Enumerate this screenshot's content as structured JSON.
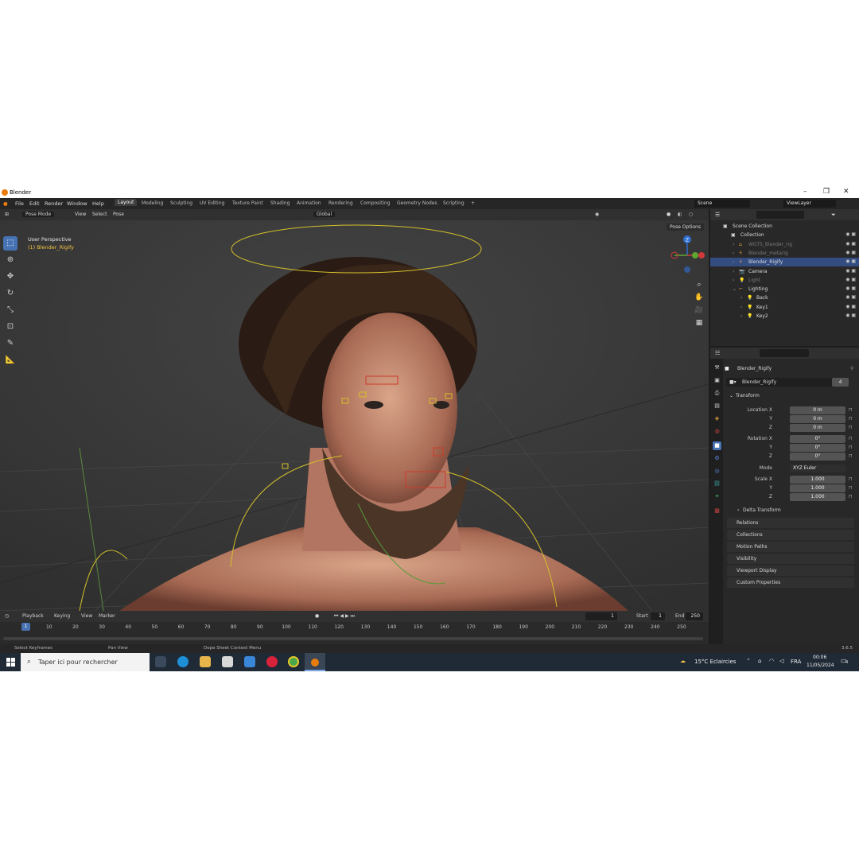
{
  "window": {
    "title": "Blender",
    "minimize": "–",
    "maximize": "❐",
    "close": "✕"
  },
  "menu": [
    "File",
    "Edit",
    "Render",
    "Window",
    "Help"
  ],
  "workspaces": [
    "Layout",
    "Modeling",
    "Sculpting",
    "UV Editing",
    "Texture Paint",
    "Shading",
    "Animation",
    "Rendering",
    "Compositing",
    "Geometry Nodes",
    "Scripting",
    "+"
  ],
  "scene": "Scene",
  "view_layer": "ViewLayer",
  "viewport": {
    "mode": "Pose Mode",
    "menus": [
      "View",
      "Select",
      "Pose"
    ],
    "orientation": "Global",
    "info_line1": "User Perspective",
    "info_line2": "(1) Blender_Rigify",
    "pose_options": "Pose Options"
  },
  "gizmo": {
    "z": "Z"
  },
  "timeline": {
    "menus": [
      "Playback",
      "Keying",
      "View",
      "Marker"
    ],
    "current_frame": "1",
    "start_label": "Start",
    "start": "1",
    "end_label": "End",
    "end": "250",
    "ticks": [
      "1",
      "10",
      "20",
      "30",
      "40",
      "50",
      "60",
      "70",
      "80",
      "90",
      "100",
      "110",
      "120",
      "130",
      "140",
      "150",
      "160",
      "170",
      "180",
      "190",
      "200",
      "210",
      "220",
      "230",
      "240",
      "250"
    ]
  },
  "status": {
    "left": "Select Keyframes",
    "middle": "Pan View",
    "right": "Dope Sheet Context Menu",
    "version": "3.6.5"
  },
  "outliner": {
    "rows": [
      {
        "label": "Scene Collection",
        "indent": 0,
        "dim": false,
        "selected": false
      },
      {
        "label": "Collection",
        "indent": 1,
        "dim": false,
        "selected": false
      },
      {
        "label": "WGTS_Blender_rig",
        "indent": 2,
        "dim": true,
        "selected": false
      },
      {
        "label": "Blender_metarig",
        "indent": 2,
        "dim": true,
        "selected": false
      },
      {
        "label": "Blender_Rigify",
        "indent": 2,
        "dim": false,
        "selected": true
      },
      {
        "label": "Camera",
        "indent": 2,
        "dim": false,
        "selected": false
      },
      {
        "label": "Light",
        "indent": 2,
        "dim": true,
        "selected": false
      },
      {
        "label": "Lighting",
        "indent": 2,
        "dim": false,
        "selected": false
      },
      {
        "label": "Back",
        "indent": 3,
        "dim": false,
        "selected": false
      },
      {
        "label": "Key1",
        "indent": 3,
        "dim": false,
        "selected": false
      },
      {
        "label": "Key2",
        "indent": 3,
        "dim": false,
        "selected": false
      }
    ]
  },
  "properties": {
    "object_name": "Blender_Rigify",
    "data_name": "Blender_Rigify",
    "users": "4",
    "transform_label": "Transform",
    "location_label": "Location X",
    "rotation_label": "Rotation X",
    "scale_label": "Scale X",
    "y_label": "Y",
    "z_label": "Z",
    "mode_label": "Mode",
    "mode_value": "XYZ Euler",
    "location": [
      "0 m",
      "0 m",
      "0 m"
    ],
    "rotation": [
      "0°",
      "0°",
      "0°"
    ],
    "scale": [
      "1.000",
      "1.000",
      "1.000"
    ],
    "delta_transform": "Delta Transform",
    "sections": [
      "Relations",
      "Collections",
      "Motion Paths",
      "Visibility",
      "Viewport Display",
      "Custom Properties"
    ]
  },
  "taskbar": {
    "search_placeholder": "Taper ici pour rechercher",
    "weather": "15°C  Eclaircies",
    "lang": "FRA",
    "time": "00:06",
    "date": "11/05/2024",
    "notifications": "4"
  },
  "colors": {
    "accent": "#4772b3",
    "rig_yellow": "#d4c02a",
    "selection": "#334d80",
    "active_text": "#f5c542"
  }
}
